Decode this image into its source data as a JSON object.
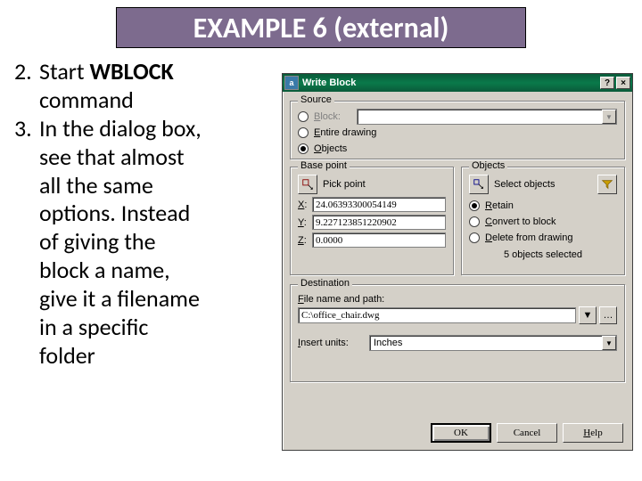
{
  "slide": {
    "title": "EXAMPLE 6 (external)",
    "item2_num": "2.",
    "item2_start": "Start ",
    "item2_bold": "WBLOCK",
    "item2_rest1": "command",
    "item3_num": "3.",
    "item3_line1": "In the dialog box,",
    "item3_line2": "see that almost",
    "item3_line3": "all the same",
    "item3_line4": "options.  Instead",
    "item3_line5": "of giving  the",
    "item3_line6": "block a name,",
    "item3_line7": "give it a filename",
    "item3_line8": "in a specific",
    "item3_line9": "folder"
  },
  "dialog": {
    "title": "Write Block",
    "help_btn": "?",
    "close_btn": "×",
    "source": {
      "legend": "Source",
      "block_label_pre": "B",
      "block_label_rest": "lock:",
      "entire_pre": "E",
      "entire_rest": "ntire drawing",
      "objects_pre": "O",
      "objects_rest": "bjects"
    },
    "basepoint": {
      "legend": "Base point",
      "pick_label": "Pick point",
      "x_label_u": "X",
      "x_label": ":",
      "x_value": "24.06393300054149",
      "y_label_u": "Y",
      "y_label": ":",
      "y_value": "9.227123851220902",
      "z_label_u": "Z",
      "z_label": ":",
      "z_value": "0.0000"
    },
    "objects": {
      "legend": "Objects",
      "select_label": "Select objects",
      "retain_pre": "R",
      "retain_rest": "etain",
      "convert_pre": "C",
      "convert_rest": "onvert to block",
      "delete_pre": "D",
      "delete_rest": "elete from drawing",
      "count": "5 objects selected"
    },
    "destination": {
      "legend": "Destination",
      "path_label_pre": "F",
      "path_label_rest": "ile name and path:",
      "path_value": "C:\\office_chair.dwg",
      "units_label_pre": "I",
      "units_label_rest": "nsert units:",
      "units_value": "Inches"
    },
    "buttons": {
      "ok": "OK",
      "cancel": "Cancel",
      "help_pre": "H",
      "help_rest": "elp"
    }
  }
}
